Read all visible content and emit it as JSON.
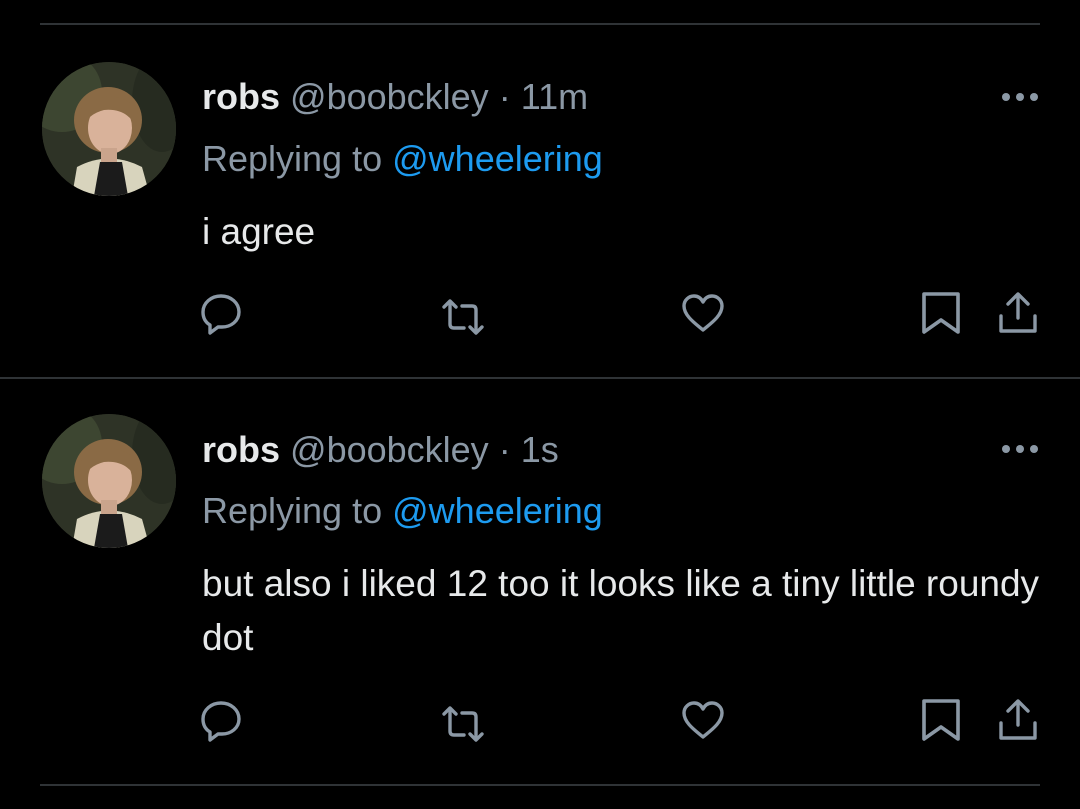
{
  "colors": {
    "background": "#000000",
    "divider": "#2f3336",
    "text": "#e7e9ea",
    "secondary": "#8b98a5",
    "accent": "#1d9bf0"
  },
  "icons": {
    "reply": "reply-icon",
    "retweet": "retweet-icon",
    "like": "heart-icon",
    "bookmark": "bookmark-icon",
    "share": "share-icon",
    "more": "more-icon"
  },
  "tweets": [
    {
      "display_name": "robs",
      "handle": "@boobckley",
      "separator": "·",
      "time": "11m",
      "replying_prefix": "Replying to",
      "replying_to": "@wheelering",
      "text": "i agree"
    },
    {
      "display_name": "robs",
      "handle": "@boobckley",
      "separator": "·",
      "time": "1s",
      "replying_prefix": "Replying to",
      "replying_to": "@wheelering",
      "text": "but also i liked 12 too it looks like a tiny little roundy dot"
    }
  ]
}
